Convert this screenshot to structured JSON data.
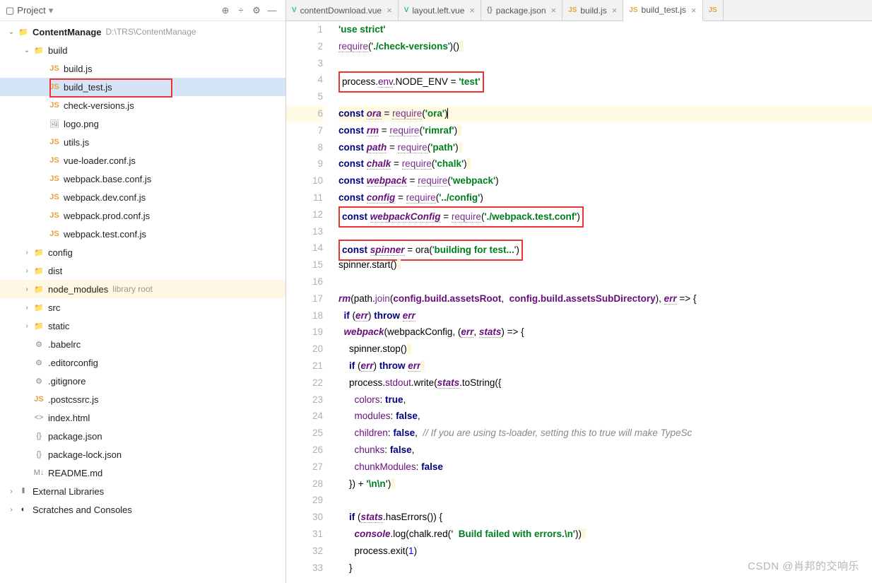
{
  "header": {
    "project_label": "Project",
    "dropdown_icon": "▾"
  },
  "tree": {
    "root_name": "ContentManage",
    "root_path": "D:\\TRS\\ContentManage",
    "nodes": [
      {
        "depth": 0,
        "chev": "v",
        "icon": "folder-root",
        "label": "ContentManage",
        "hint": "D:\\TRS\\ContentManage"
      },
      {
        "depth": 1,
        "chev": "v",
        "icon": "folder",
        "label": "build"
      },
      {
        "depth": 2,
        "icon": "js",
        "label": "build.js"
      },
      {
        "depth": 2,
        "icon": "js",
        "label": "build_test.js",
        "selected": true,
        "boxed": true
      },
      {
        "depth": 2,
        "icon": "js",
        "label": "check-versions.js"
      },
      {
        "depth": 2,
        "icon": "img",
        "label": "logo.png"
      },
      {
        "depth": 2,
        "icon": "js",
        "label": "utils.js"
      },
      {
        "depth": 2,
        "icon": "js",
        "label": "vue-loader.conf.js"
      },
      {
        "depth": 2,
        "icon": "js",
        "label": "webpack.base.conf.js"
      },
      {
        "depth": 2,
        "icon": "js",
        "label": "webpack.dev.conf.js"
      },
      {
        "depth": 2,
        "icon": "js",
        "label": "webpack.prod.conf.js"
      },
      {
        "depth": 2,
        "icon": "js",
        "label": "webpack.test.conf.js"
      },
      {
        "depth": 1,
        "chev": ">",
        "icon": "folder",
        "label": "config"
      },
      {
        "depth": 1,
        "chev": ">",
        "icon": "folder",
        "label": "dist"
      },
      {
        "depth": 1,
        "chev": ">",
        "icon": "folder",
        "label": "node_modules",
        "hint": "library root",
        "nm": true
      },
      {
        "depth": 1,
        "chev": ">",
        "icon": "folder",
        "label": "src"
      },
      {
        "depth": 1,
        "chev": ">",
        "icon": "folder",
        "label": "static"
      },
      {
        "depth": 1,
        "icon": "cfg",
        "label": ".babelrc"
      },
      {
        "depth": 1,
        "icon": "cfg",
        "label": ".editorconfig"
      },
      {
        "depth": 1,
        "icon": "cfg",
        "label": ".gitignore"
      },
      {
        "depth": 1,
        "icon": "js",
        "label": ".postcssrc.js"
      },
      {
        "depth": 1,
        "icon": "html",
        "label": "index.html"
      },
      {
        "depth": 1,
        "icon": "json",
        "label": "package.json"
      },
      {
        "depth": 1,
        "icon": "json",
        "label": "package-lock.json"
      },
      {
        "depth": 1,
        "icon": "md",
        "label": "README.md"
      }
    ],
    "external_libs": "External Libraries",
    "scratches": "Scratches and Consoles"
  },
  "tabs": [
    {
      "icon": "vue",
      "label": "contentDownload.vue"
    },
    {
      "icon": "vue",
      "label": "layout.left.vue"
    },
    {
      "icon": "json",
      "label": "package.json"
    },
    {
      "icon": "js",
      "label": "build.js"
    },
    {
      "icon": "js",
      "label": "build_test.js",
      "active": true
    }
  ],
  "code": {
    "line_count": 33,
    "caret_line": 6,
    "lines": {
      "l1": "'use strict'",
      "l2_a": "require",
      "l2_b": "('",
      "l2_c": "./check-versions",
      "l2_d": "')()",
      "l4_a": "process.",
      "l4_b": "env",
      "l4_c": ".NODE_ENV = ",
      "l4_d": "'test'",
      "l6_a": "const ",
      "l6_b": "ora",
      "l6_c": " = ",
      "l6_d": "require",
      "l6_e": "('",
      "l6_f": "ora",
      "l6_g": "')",
      "l7_a": "const ",
      "l7_b": "rm",
      "l7_c": " = ",
      "l7_d": "require",
      "l7_e": "('",
      "l7_f": "rimraf",
      "l7_g": "')",
      "l8_a": "const ",
      "l8_b": "path",
      "l8_c": " = ",
      "l8_d": "require",
      "l8_e": "('",
      "l8_f": "path",
      "l8_g": "')",
      "l9_a": "const ",
      "l9_b": "chalk",
      "l9_c": " = ",
      "l9_d": "require",
      "l9_e": "('",
      "l9_f": "chalk",
      "l9_g": "')",
      "l10_a": "const ",
      "l10_b": "webpack",
      "l10_c": " = ",
      "l10_d": "require",
      "l10_e": "('",
      "l10_f": "webpack",
      "l10_g": "')",
      "l11_a": "const ",
      "l11_b": "config",
      "l11_c": " = ",
      "l11_d": "require",
      "l11_e": "('",
      "l11_f": "../config",
      "l11_g": "')",
      "l12_a": "const ",
      "l12_b": "webpackConfig",
      "l12_c": " = ",
      "l12_d": "require",
      "l12_e": "('",
      "l12_f": "./webpack.test.conf",
      "l12_g": "')",
      "l14_a": "const ",
      "l14_b": "spinner",
      "l14_c": " = ora('",
      "l14_d": "building for test...",
      "l14_e": "')",
      "l15": "spinner.start()",
      "l17_a": "rm",
      "l17_b": "(path.",
      "l17_c": "join",
      "l17_d": "(",
      "l17_e": "config.build.assetsRoot",
      "l17_f": ",  ",
      "l17_g": "config.build.assetsSubDirectory",
      "l17_h": "), ",
      "l17_i": "err",
      "l17_j": " => {",
      "l18_a": "if ",
      "l18_b": "(",
      "l18_c": "err",
      "l18_d": ") ",
      "l18_e": "throw ",
      "l18_f": "err",
      "l19_a": "webpack",
      "l19_b": "(webpackConfig, (",
      "l19_c": "err",
      "l19_d": ", ",
      "l19_e": "stats",
      "l19_f": ") => {",
      "l20": "spinner.stop()",
      "l21_a": "if ",
      "l21_b": "(",
      "l21_c": "err",
      "l21_d": ") ",
      "l21_e": "throw ",
      "l21_f": "err",
      "l22_a": "process.",
      "l22_b": "stdout",
      "l22_c": ".write(",
      "l22_d": "stats",
      "l22_e": ".toString({",
      "l23_a": "colors",
      "l23_b": ": ",
      "l23_c": "true",
      "l23_d": ",",
      "l24_a": "modules",
      "l24_b": ": ",
      "l24_c": "false",
      "l24_d": ",",
      "l25_a": "children",
      "l25_b": ": ",
      "l25_c": "false",
      "l25_d": ",  ",
      "l25_e": "// If you are using ts-loader, setting this to true will make TypeSc",
      "l26_a": "chunks",
      "l26_b": ": ",
      "l26_c": "false",
      "l26_d": ",",
      "l27_a": "chunkModules",
      "l27_b": ": ",
      "l27_c": "false",
      "l28_a": "}) + '",
      "l28_b": "\\n\\n",
      "l28_c": "')",
      "l30_a": "if ",
      "l30_b": "(",
      "l30_c": "stats",
      "l30_d": ".hasErrors()) {",
      "l31_a": "console",
      "l31_b": ".log(chalk.red('",
      "l31_c": "  Build failed with errors.\\n",
      "l31_d": "'))",
      "l32": "process.exit(1)",
      "l33": "}"
    }
  },
  "watermark": "CSDN @肖邦的交响乐"
}
